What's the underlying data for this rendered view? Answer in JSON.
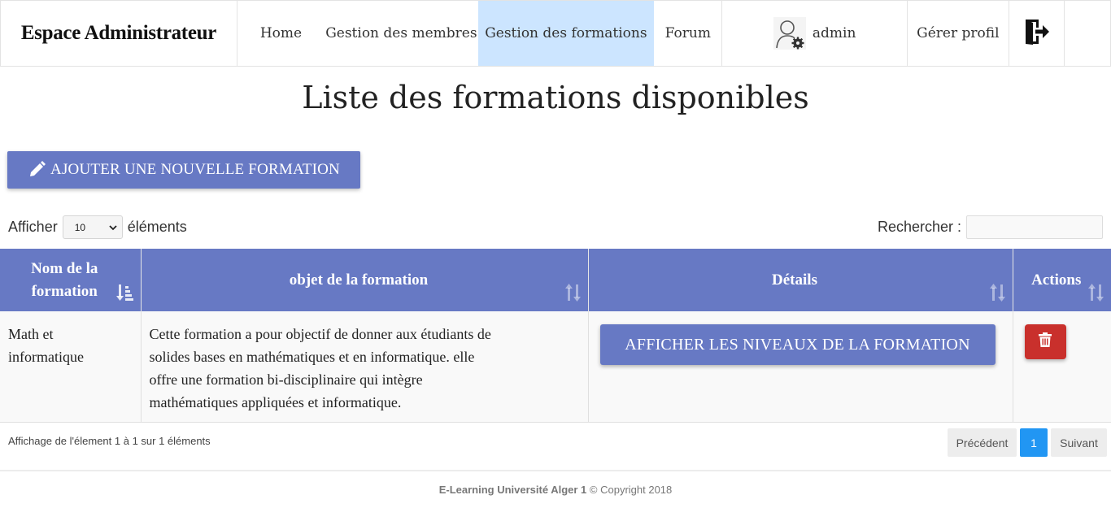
{
  "navbar": {
    "brand": "Espace Administrateur",
    "items": [
      {
        "label": "Home"
      },
      {
        "label": "Gestion des membres"
      },
      {
        "label": "Gestion des formations",
        "active": true
      },
      {
        "label": "Forum"
      }
    ],
    "user": {
      "name": "admin",
      "icon": "admin-user-gear-icon"
    },
    "profile_label": "Gérer profil",
    "logout_icon": "logout-icon"
  },
  "page": {
    "title": "Liste des formations disponibles",
    "add_button_label": "AJOUTER UNE NOUVELLE FORMATION",
    "add_button_icon": "pencil-icon"
  },
  "controls": {
    "show_label": "Afficher",
    "show_value": "10",
    "elements_label": "éléments",
    "search_label": "Rechercher :",
    "search_value": ""
  },
  "table": {
    "headers": [
      {
        "line1": "Nom de la",
        "line2": "formation"
      },
      {
        "label": "objet de la formation"
      },
      {
        "label": "Détails"
      },
      {
        "label": "Actions"
      }
    ],
    "rows": [
      {
        "name_line1": "Math et",
        "name_line2": "informatique",
        "objet_lines": [
          "Cette formation a pour objectif de donner aux étudiants de",
          "solides bases en mathématiques et en informatique. elle",
          "offre une formation bi-disciplinaire qui intègre",
          "mathématiques appliquées et informatique."
        ],
        "details_button": "AFFICHER LES NIVEAUX DE LA FORMATION",
        "action_icon": "trash-icon"
      }
    ]
  },
  "pagination": {
    "info": "Affichage de l'élement 1 à 1 sur 1 éléments",
    "prev": "Précédent",
    "current": "1",
    "next": "Suivant"
  },
  "footer": {
    "brand": "E-Learning Université Alger 1",
    "copyright": " © Copyright 2018"
  },
  "colors": {
    "primary": "#6779c4",
    "active_nav": "#cce5ff",
    "danger": "#c9302c",
    "page_active": "#2196f3"
  }
}
